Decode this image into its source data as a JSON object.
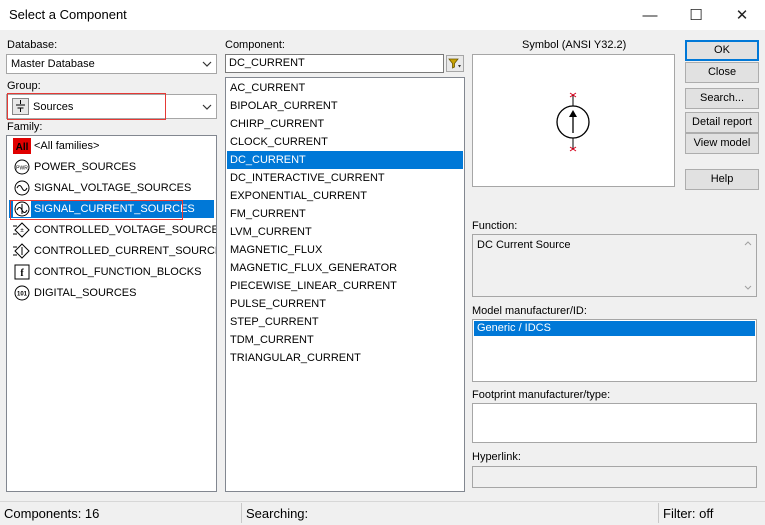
{
  "window": {
    "title": "Select a Component",
    "minimize_glyph": "—",
    "maximize_glyph": "☐",
    "close_glyph": "✕"
  },
  "database": {
    "label": "Database:",
    "value": "Master Database"
  },
  "group": {
    "label": "Group:",
    "value": "Sources"
  },
  "family": {
    "label": "Family:",
    "items": [
      {
        "label": "<All families>",
        "icon": "all-families-icon",
        "selected": false
      },
      {
        "label": "POWER_SOURCES",
        "icon": "power-sources-icon",
        "selected": false
      },
      {
        "label": "SIGNAL_VOLTAGE_SOURCES",
        "icon": "signal-voltage-icon",
        "selected": false
      },
      {
        "label": "SIGNAL_CURRENT_SOURCES",
        "icon": "signal-current-icon",
        "selected": true
      },
      {
        "label": "CONTROLLED_VOLTAGE_SOURCES",
        "icon": "controlled-voltage-icon",
        "selected": false
      },
      {
        "label": "CONTROLLED_CURRENT_SOURCES",
        "icon": "controlled-current-icon",
        "selected": false
      },
      {
        "label": "CONTROL_FUNCTION_BLOCKS",
        "icon": "control-function-icon",
        "selected": false
      },
      {
        "label": "DIGITAL_SOURCES",
        "icon": "digital-sources-icon",
        "selected": false
      }
    ],
    "all_icon_text": "All",
    "control_icon_text": "f",
    "digital_icon_text": "101",
    "power_icon_text": "PWR"
  },
  "component": {
    "label": "Component:",
    "search_value": "DC_CURRENT",
    "items": [
      "AC_CURRENT",
      "BIPOLAR_CURRENT",
      "CHIRP_CURRENT",
      "CLOCK_CURRENT",
      "DC_CURRENT",
      "DC_INTERACTIVE_CURRENT",
      "EXPONENTIAL_CURRENT",
      "FM_CURRENT",
      "LVM_CURRENT",
      "MAGNETIC_FLUX",
      "MAGNETIC_FLUX_GENERATOR",
      "PIECEWISE_LINEAR_CURRENT",
      "PULSE_CURRENT",
      "STEP_CURRENT",
      "TDM_CURRENT",
      "TRIANGULAR_CURRENT"
    ],
    "selected_index": 4
  },
  "symbol": {
    "label": "Symbol (ANSI Y32.2)"
  },
  "function": {
    "label": "Function:",
    "value": "DC Current Source"
  },
  "model": {
    "label": "Model manufacturer/ID:",
    "items": [
      "Generic / IDCS"
    ]
  },
  "footprint": {
    "label": "Footprint manufacturer/type:"
  },
  "hyperlink": {
    "label": "Hyperlink:"
  },
  "buttons": {
    "ok": "OK",
    "close": "Close",
    "search": "Search...",
    "detail_report": "Detail report",
    "view_model": "View model",
    "help": "Help"
  },
  "status": {
    "components": "Components: 16",
    "searching": "Searching:",
    "filter": "Filter: off"
  },
  "colors": {
    "selection": "#0078d7",
    "highlight_box": "#e53935",
    "symbol_red": "#d6001c"
  }
}
